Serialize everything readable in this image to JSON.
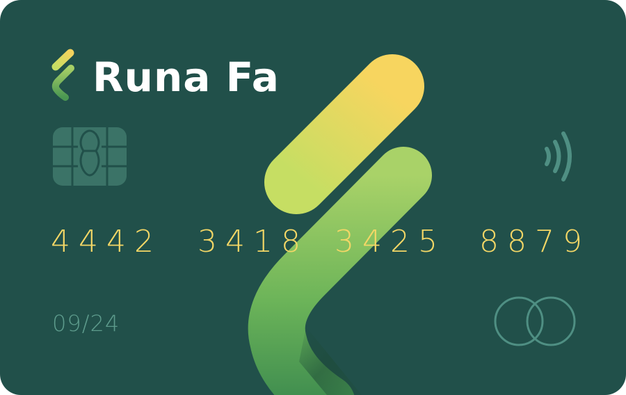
{
  "card": {
    "brand_name": "Runa Fa",
    "number_groups": [
      "4442",
      "3418",
      "3425",
      "8879"
    ],
    "expiry": "09/24"
  },
  "icons": {
    "brand": "runa-logo-mark-icon",
    "chip": "emv-chip-icon",
    "contactless": "contactless-payment-icon",
    "network": "interlocking-circles-network-icon"
  },
  "colors": {
    "card_background": "#21504a",
    "number_text": "#f4d766",
    "expiry_text": "#5d9b8c",
    "brand_text": "#ffffff",
    "accent_yellow": "#f6d45f",
    "accent_green": "#6fb85a",
    "icon_teal": "#4f8f83"
  }
}
